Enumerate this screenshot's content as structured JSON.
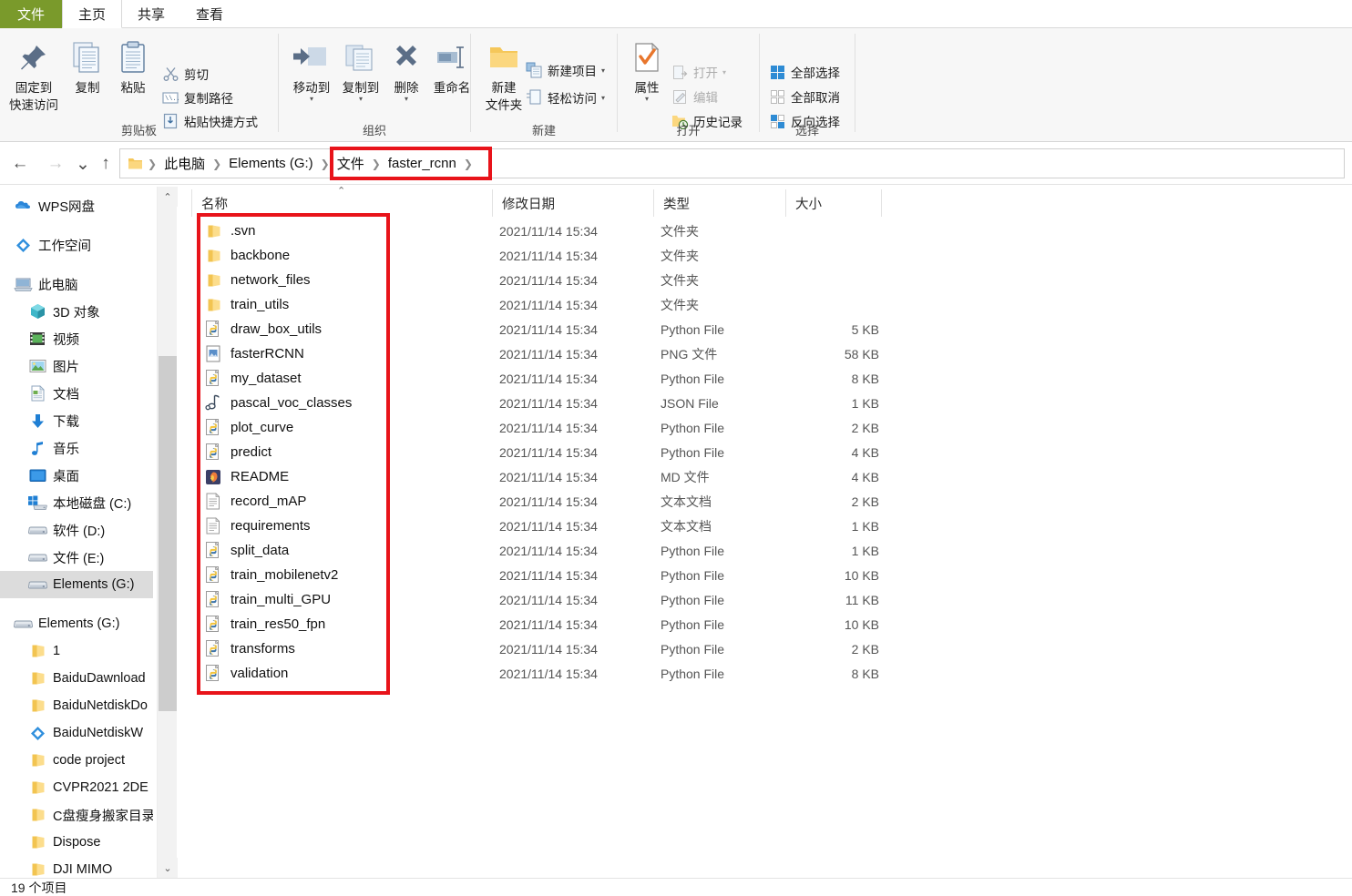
{
  "window": {
    "tabs": [
      {
        "id": "file",
        "label": "文件",
        "active": false
      },
      {
        "id": "home",
        "label": "主页",
        "active": true
      },
      {
        "id": "share",
        "label": "共享",
        "active": false
      },
      {
        "id": "view",
        "label": "查看",
        "active": false
      }
    ],
    "file_tab_color": "#7a9a2b"
  },
  "ribbon": {
    "groups": [
      {
        "id": "clipboard",
        "label": "剪贴板"
      },
      {
        "id": "organize",
        "label": "组织"
      },
      {
        "id": "new",
        "label": "新建"
      },
      {
        "id": "open",
        "label": "打开"
      },
      {
        "id": "select",
        "label": "选择"
      }
    ],
    "clipboard": {
      "pin_label_line1": "固定到",
      "pin_label_line2": "快速访问",
      "copy_label": "复制",
      "paste_label": "粘贴",
      "cut_label": "剪切",
      "copy_path_label": "复制路径",
      "paste_shortcut_label": "粘贴快捷方式"
    },
    "organize": {
      "move_to_label": "移动到",
      "copy_to_label": "复制到",
      "delete_label": "删除",
      "rename_label": "重命名"
    },
    "new": {
      "new_folder_line1": "新建",
      "new_folder_line2": "文件夹",
      "new_item_label": "新建项目",
      "easy_access_label": "轻松访问"
    },
    "open": {
      "properties_label": "属性",
      "open_label": "打开",
      "edit_label": "编辑",
      "history_label": "历史记录"
    },
    "select": {
      "select_all_label": "全部选择",
      "select_none_label": "全部取消",
      "invert_label": "反向选择"
    }
  },
  "addressbar": {
    "back_glyph": "←",
    "forward_glyph": "→",
    "recent_glyph": "⌄",
    "up_glyph": "↑",
    "crumbs": [
      {
        "label": "此电脑"
      },
      {
        "label": "Elements (G:)"
      },
      {
        "label": "文件"
      },
      {
        "label": "faster_rcnn"
      }
    ],
    "separator": "❯"
  },
  "sidebar": {
    "items": [
      {
        "label": "WPS网盘",
        "icon": "cloud-icon",
        "indent": 0,
        "selected": false,
        "gap_before": false
      },
      {
        "label": "工作空间",
        "icon": "diamond-icon",
        "indent": 0,
        "selected": false,
        "gap_before": true
      },
      {
        "label": "此电脑",
        "icon": "pc-icon",
        "indent": 0,
        "selected": false,
        "gap_before": true
      },
      {
        "label": "3D 对象",
        "icon": "cube-icon",
        "indent": 1,
        "selected": false,
        "gap_before": false
      },
      {
        "label": "视频",
        "icon": "video-icon",
        "indent": 1,
        "selected": false,
        "gap_before": false
      },
      {
        "label": "图片",
        "icon": "picture-icon",
        "indent": 1,
        "selected": false,
        "gap_before": false
      },
      {
        "label": "文档",
        "icon": "document-icon",
        "indent": 1,
        "selected": false,
        "gap_before": false
      },
      {
        "label": "下载",
        "icon": "download-icon",
        "indent": 1,
        "selected": false,
        "gap_before": false
      },
      {
        "label": "音乐",
        "icon": "music-icon",
        "indent": 1,
        "selected": false,
        "gap_before": false
      },
      {
        "label": "桌面",
        "icon": "desktop-icon",
        "indent": 1,
        "selected": false,
        "gap_before": false
      },
      {
        "label": "本地磁盘 (C:)",
        "icon": "windrive-icon",
        "indent": 1,
        "selected": false,
        "gap_before": false
      },
      {
        "label": "软件 (D:)",
        "icon": "drive-icon",
        "indent": 1,
        "selected": false,
        "gap_before": false
      },
      {
        "label": "文件 (E:)",
        "icon": "drive-icon",
        "indent": 1,
        "selected": false,
        "gap_before": false
      },
      {
        "label": "Elements (G:)",
        "icon": "drive-icon",
        "indent": 1,
        "selected": true,
        "gap_before": false
      },
      {
        "label": "Elements (G:)",
        "icon": "drive-icon",
        "indent": 0,
        "selected": false,
        "gap_before": true
      },
      {
        "label": "1",
        "icon": "folder-icon",
        "indent": 1,
        "selected": false,
        "gap_before": false
      },
      {
        "label": "BaiduDawnload",
        "icon": "folder-icon",
        "indent": 1,
        "selected": false,
        "gap_before": false
      },
      {
        "label": "BaiduNetdiskDo",
        "icon": "folder-icon",
        "indent": 1,
        "selected": false,
        "gap_before": false
      },
      {
        "label": "BaiduNetdiskW",
        "icon": "diamond-icon",
        "indent": 1,
        "selected": false,
        "gap_before": false
      },
      {
        "label": "code project",
        "icon": "folder-icon",
        "indent": 1,
        "selected": false,
        "gap_before": false
      },
      {
        "label": "CVPR2021 2DE",
        "icon": "folder-icon",
        "indent": 1,
        "selected": false,
        "gap_before": false
      },
      {
        "label": "C盘瘦身搬家目录",
        "icon": "folder-icon",
        "indent": 1,
        "selected": false,
        "gap_before": false
      },
      {
        "label": "Dispose",
        "icon": "folder-icon",
        "indent": 1,
        "selected": false,
        "gap_before": false
      },
      {
        "label": "DJI MIMO",
        "icon": "folder-icon",
        "indent": 1,
        "selected": false,
        "gap_before": false
      }
    ]
  },
  "filelist": {
    "columns": [
      {
        "id": "name",
        "label": "名称",
        "sorted": true
      },
      {
        "id": "date",
        "label": "修改日期"
      },
      {
        "id": "type",
        "label": "类型"
      },
      {
        "id": "size",
        "label": "大小"
      }
    ],
    "sort_glyph": "⌃",
    "rows": [
      {
        "name": ".svn",
        "date": "2021/11/14 15:34",
        "type": "文件夹",
        "size": "",
        "icon": "folder-icon"
      },
      {
        "name": "backbone",
        "date": "2021/11/14 15:34",
        "type": "文件夹",
        "size": "",
        "icon": "folder-icon"
      },
      {
        "name": "network_files",
        "date": "2021/11/14 15:34",
        "type": "文件夹",
        "size": "",
        "icon": "folder-icon"
      },
      {
        "name": "train_utils",
        "date": "2021/11/14 15:34",
        "type": "文件夹",
        "size": "",
        "icon": "folder-icon"
      },
      {
        "name": "draw_box_utils",
        "date": "2021/11/14 15:34",
        "type": "Python File",
        "size": "5 KB",
        "icon": "python-icon"
      },
      {
        "name": "fasterRCNN",
        "date": "2021/11/14 15:34",
        "type": "PNG 文件",
        "size": "58 KB",
        "icon": "png-icon"
      },
      {
        "name": "my_dataset",
        "date": "2021/11/14 15:34",
        "type": "Python File",
        "size": "8 KB",
        "icon": "python-icon"
      },
      {
        "name": "pascal_voc_classes",
        "date": "2021/11/14 15:34",
        "type": "JSON File",
        "size": "1 KB",
        "icon": "json-icon"
      },
      {
        "name": "plot_curve",
        "date": "2021/11/14 15:34",
        "type": "Python File",
        "size": "2 KB",
        "icon": "python-icon"
      },
      {
        "name": "predict",
        "date": "2021/11/14 15:34",
        "type": "Python File",
        "size": "4 KB",
        "icon": "python-icon"
      },
      {
        "name": "README",
        "date": "2021/11/14 15:34",
        "type": "MD 文件",
        "size": "4 KB",
        "icon": "markdown-icon"
      },
      {
        "name": "record_mAP",
        "date": "2021/11/14 15:34",
        "type": "文本文档",
        "size": "2 KB",
        "icon": "text-icon"
      },
      {
        "name": "requirements",
        "date": "2021/11/14 15:34",
        "type": "文本文档",
        "size": "1 KB",
        "icon": "text-icon"
      },
      {
        "name": "split_data",
        "date": "2021/11/14 15:34",
        "type": "Python File",
        "size": "1 KB",
        "icon": "python-icon"
      },
      {
        "name": "train_mobilenetv2",
        "date": "2021/11/14 15:34",
        "type": "Python File",
        "size": "10 KB",
        "icon": "python-icon"
      },
      {
        "name": "train_multi_GPU",
        "date": "2021/11/14 15:34",
        "type": "Python File",
        "size": "11 KB",
        "icon": "python-icon"
      },
      {
        "name": "train_res50_fpn",
        "date": "2021/11/14 15:34",
        "type": "Python File",
        "size": "10 KB",
        "icon": "python-icon"
      },
      {
        "name": "transforms",
        "date": "2021/11/14 15:34",
        "type": "Python File",
        "size": "2 KB",
        "icon": "python-icon"
      },
      {
        "name": "validation",
        "date": "2021/11/14 15:34",
        "type": "Python File",
        "size": "8 KB",
        "icon": "python-icon"
      }
    ]
  },
  "statusbar": {
    "item_count_text": "19 个项目"
  },
  "annotations": {
    "highlight_color": "#e8131a",
    "boxes": [
      {
        "id": "breadcrumb-highlight",
        "target": "address-bar-crumbs"
      },
      {
        "id": "filenames-highlight",
        "target": "file-name-column"
      }
    ]
  }
}
